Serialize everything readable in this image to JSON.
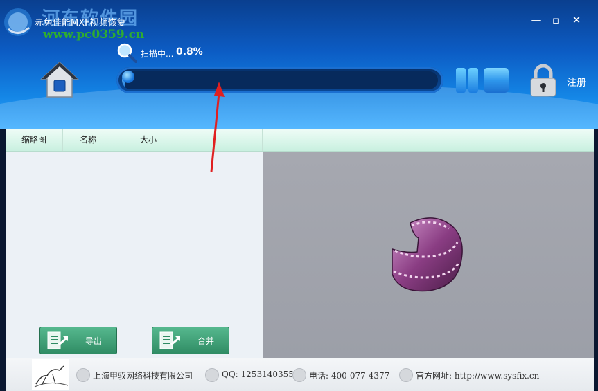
{
  "window": {
    "title": "赤兔佳能MXF视频恢复",
    "controls": {
      "minimize": "—",
      "maximize": "▫",
      "close": "✕"
    }
  },
  "watermark": {
    "title": "河东软件园",
    "url": "www.pc0359.cn"
  },
  "scan": {
    "status": "扫描中...",
    "percent_label": "0.8%",
    "progress_fraction": 0.008
  },
  "header": {
    "register_label": "注册"
  },
  "table": {
    "columns": [
      "缩略图",
      "名称",
      "大小"
    ]
  },
  "actions": {
    "export_label": "导出",
    "merge_label": "合并"
  },
  "footer": {
    "company": "上海甲驭网络科技有限公司",
    "qq": "QQ: 1253140355",
    "phone": "电话: 400-077-4377",
    "website": "官方网址: http://www.sysfix.cn"
  },
  "colors": {
    "header_top": "#0a3f8f",
    "header_bottom": "#30a8ff",
    "button_green": "#2f8b63",
    "annotation_arrow": "#e02020"
  },
  "icons": [
    "app-logo-icon",
    "home-icon",
    "magnifier-icon",
    "pause-icon",
    "stop-icon",
    "lock-icon",
    "film-reel-icon",
    "export-icon",
    "merge-icon",
    "company-icon",
    "qq-icon",
    "phone-icon",
    "globe-icon"
  ]
}
